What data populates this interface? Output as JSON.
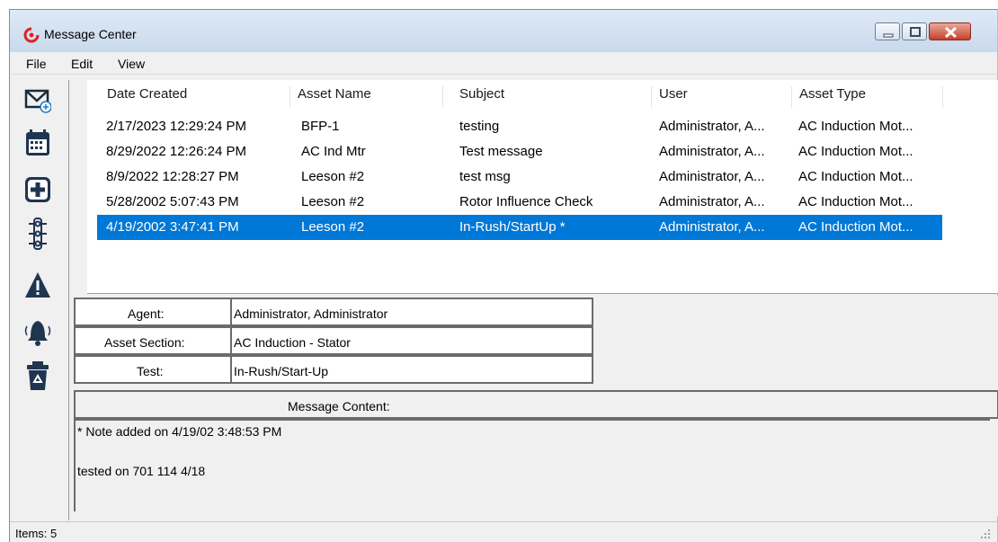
{
  "window": {
    "title": "Message Center",
    "colors": {
      "selection": "#0078d7",
      "close_button": "#c4402b",
      "title_bar": "#d3e1f1"
    }
  },
  "menu": [
    "File",
    "Edit",
    "View"
  ],
  "toolbar": {
    "icons": [
      "new-message-icon",
      "calendar-icon",
      "add-icon",
      "traffic-light-icon",
      "warning-icon",
      "alarm-bell-icon",
      "recycle-bin-icon"
    ]
  },
  "table": {
    "columns": [
      "Date Created",
      "Asset Name",
      "Subject",
      "User",
      "Asset Type"
    ],
    "rows": [
      [
        "2/17/2023 12:29:24 PM",
        "BFP-1",
        "testing",
        "Administrator, A...",
        "AC Induction Mot..."
      ],
      [
        "8/29/2022 12:26:24 PM",
        "AC Ind Mtr",
        "Test message",
        "Administrator, A...",
        "AC Induction Mot..."
      ],
      [
        "8/9/2022 12:28:27 PM",
        "Leeson #2",
        "test msg",
        "Administrator, A...",
        "AC Induction Mot..."
      ],
      [
        "5/28/2002 5:07:43 PM",
        "Leeson #2",
        "Rotor Influence Check",
        "Administrator, A...",
        "AC Induction Mot..."
      ],
      [
        "4/19/2002 3:47:41 PM",
        "Leeson #2",
        "In-Rush/StartUp *",
        "Administrator, A...",
        "AC Induction Mot..."
      ]
    ],
    "selected_row": 4
  },
  "detail": {
    "agent_label": "Agent:",
    "agent_value": "Administrator, Administrator",
    "section_label": "Asset Section:",
    "section_value": "AC Induction - Stator",
    "test_label": "Test:",
    "test_value": "In-Rush/Start-Up",
    "content_label": "Message Content:",
    "content_line1": "* Note added on 4/19/02 3:48:53 PM",
    "content_line2": "tested on 701 114 4/18"
  },
  "status": {
    "items": "Items: 5"
  }
}
